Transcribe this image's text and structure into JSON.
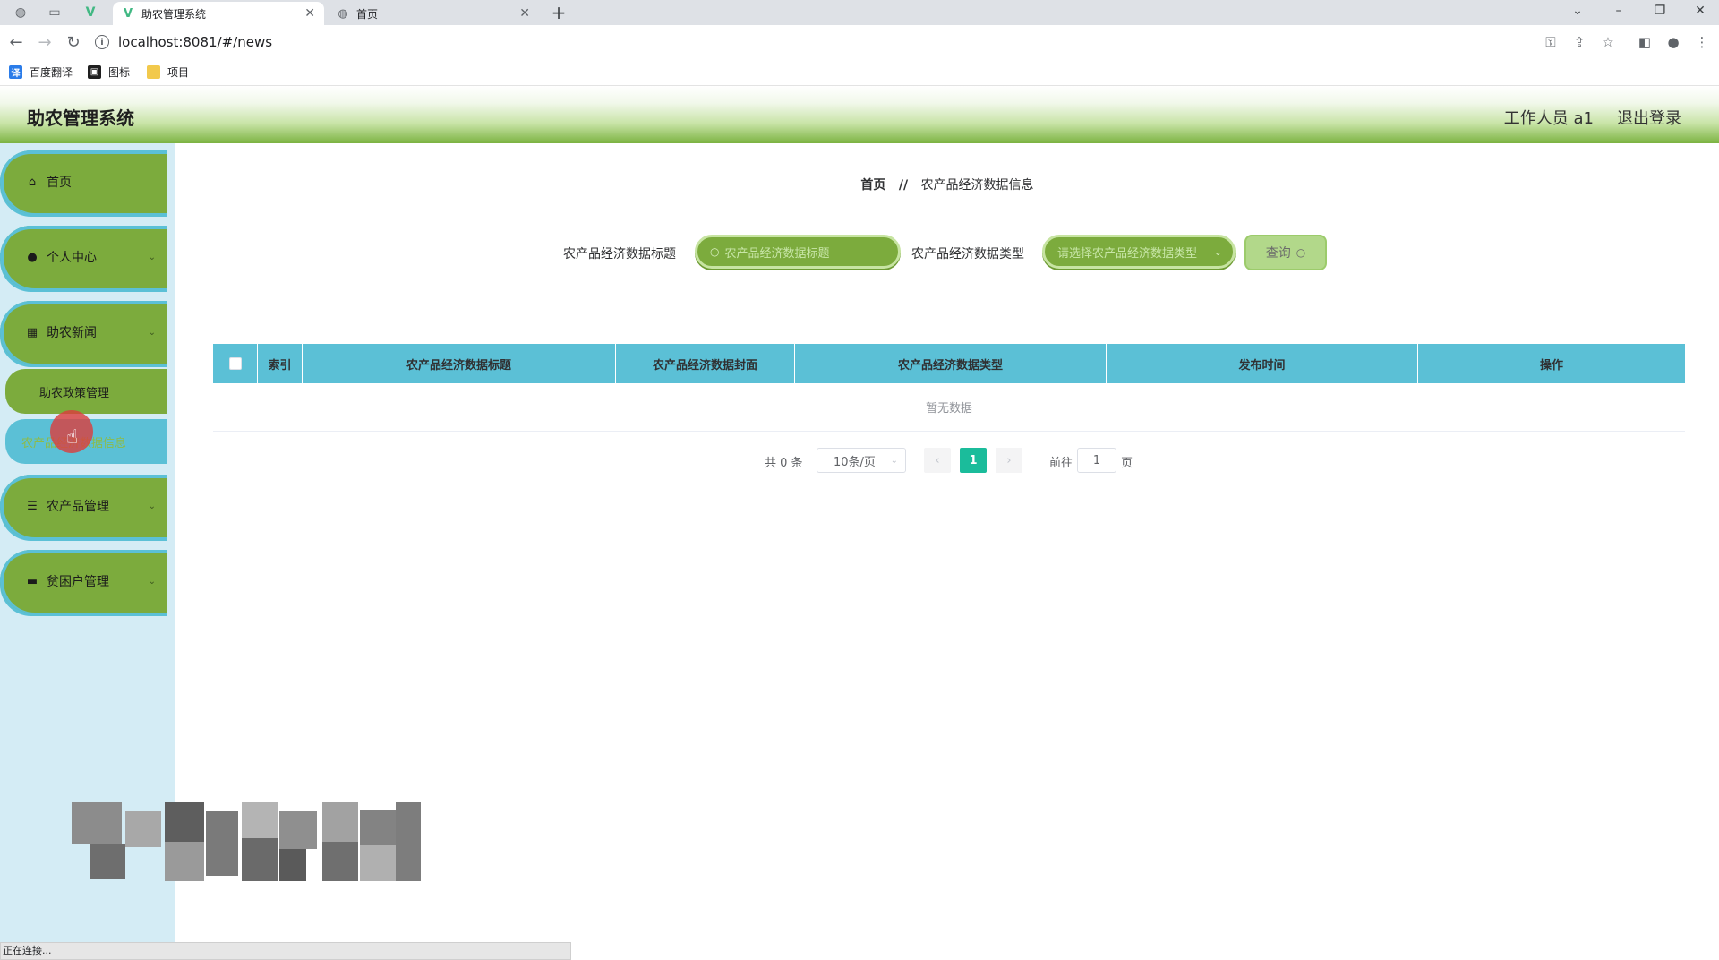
{
  "browser": {
    "tabs": [
      {
        "title": "助农管理系统",
        "active": true
      },
      {
        "title": "首页",
        "active": false
      }
    ],
    "url": "localhost:8081/#/news",
    "bookmarks": [
      "百度翻译",
      "图标",
      "项目"
    ],
    "status_text": "正在连接..."
  },
  "header": {
    "title": "助农管理系统",
    "user": "工作人员 a1",
    "logout": "退出登录"
  },
  "sidebar": {
    "items": [
      {
        "label": "首页",
        "icon": "home-icon"
      },
      {
        "label": "个人中心",
        "icon": "user-icon"
      },
      {
        "label": "助农新闻",
        "icon": "grid-icon"
      },
      {
        "label": "农产品管理",
        "icon": "list-icon"
      },
      {
        "label": "贫困户管理",
        "icon": "monitor-icon"
      }
    ],
    "sub_items": [
      {
        "label": "助农政策管理"
      },
      {
        "label": "农产品经济数据信息"
      }
    ]
  },
  "breadcrumb": {
    "home": "首页",
    "separator": "//",
    "current": "农产品经济数据信息"
  },
  "search": {
    "title_label": "农产品经济数据标题",
    "title_placeholder": "农产品经济数据标题",
    "type_label": "农产品经济数据类型",
    "type_placeholder": "请选择农产品经济数据类型",
    "query_button": "查询"
  },
  "table": {
    "columns": [
      "索引",
      "农产品经济数据标题",
      "农产品经济数据封面",
      "农产品经济数据类型",
      "发布时间",
      "操作"
    ],
    "empty_text": "暂无数据"
  },
  "pagination": {
    "total": "共 0 条",
    "page_size": "10条/页",
    "current_page": "1",
    "goto_label": "前往",
    "goto_value": "1",
    "page_suffix": "页"
  },
  "colors": {
    "accent_green": "#7cab3d",
    "accent_cyan": "#5bc0d6",
    "pager_active": "#1bbc9b"
  }
}
